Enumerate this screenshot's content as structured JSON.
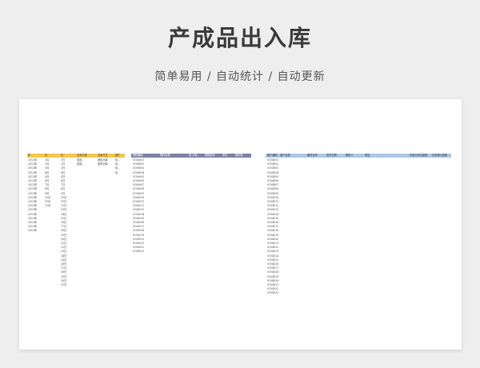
{
  "header": {
    "title": "产成品出入库",
    "subtitle": "简单易用 / 自动统计 / 自动更新"
  },
  "colors": {
    "yellow_header": "#f3c84b",
    "purple_header": "#7e82a7",
    "blue_header": "#a9c8e6",
    "sheet_bg": "#ffffff",
    "page_bg": "#eeeeee"
  },
  "table1": {
    "headers": [
      "年",
      "月",
      "日",
      "业务分类",
      "出库方式",
      "部门"
    ],
    "years": [
      "2013年",
      "2013年",
      "2013年",
      "2013年",
      "2013年",
      "2013年",
      "2013年",
      "2013年",
      "2013年",
      "2013年",
      "2013年",
      "2013年",
      "2013年",
      "2013年",
      "2013年",
      "2013年",
      "2013年",
      "2013年"
    ],
    "months": [
      "1月",
      "2月",
      "3月",
      "4月",
      "5月",
      "6月",
      "7月",
      "8月",
      "9月",
      "10月",
      "11月",
      "12月"
    ],
    "days": [
      "1日",
      "2日",
      "3日",
      "4日",
      "5日",
      "6日",
      "7日",
      "8日",
      "9日",
      "10日",
      "11日",
      "12日",
      "13日",
      "14日",
      "15日",
      "16日",
      "17日",
      "18日",
      "19日",
      "20日",
      "21日",
      "22日",
      "23日",
      "24日",
      "25日",
      "26日",
      "27日",
      "28日",
      "29日",
      "30日",
      "31日"
    ],
    "categories": [
      "成品...",
      "成品..."
    ],
    "methods": [
      "销售出库",
      "退货出库"
    ],
    "departments": [
      "包...",
      "包...",
      "包...",
      "包..."
    ]
  },
  "table2": {
    "headers": [
      "物料编码",
      "物料名称",
      "",
      "品 计量",
      "规格型号",
      "单位",
      "期初数"
    ],
    "codes": [
      "0108001",
      "0108002",
      "0108003",
      "0108004",
      "0108005",
      "0108006",
      "0108007",
      "0108008",
      "0108009",
      "0108010",
      "0108011",
      "0108012",
      "0108013",
      "0108014",
      "0108015",
      "0108016",
      "0108017",
      "0108018",
      "0108019",
      "0108020",
      "0108021",
      "0108022",
      "0108023"
    ]
  },
  "table3": {
    "headers": [
      "客户编码",
      "客户名称",
      "",
      "编号名称",
      "发货日期",
      "联系人",
      "电话",
      "",
      "年度业务总金额",
      "往来借口金额"
    ],
    "codes": [
      "0104001",
      "0104002",
      "0104003",
      "0104004",
      "0104005",
      "0104006",
      "0104007",
      "0104008",
      "0104009",
      "0104010",
      "0104011",
      "0104012",
      "0104013",
      "0104014",
      "0104015",
      "0104016",
      "0104017",
      "0104018",
      "0104019",
      "0104020",
      "0104021",
      "0104022",
      "0104023",
      "0104024",
      "0104025",
      "0104026",
      "0104027",
      "0104028",
      "0104029",
      "0104030",
      "0104031",
      "0104032",
      "0104033"
    ]
  }
}
